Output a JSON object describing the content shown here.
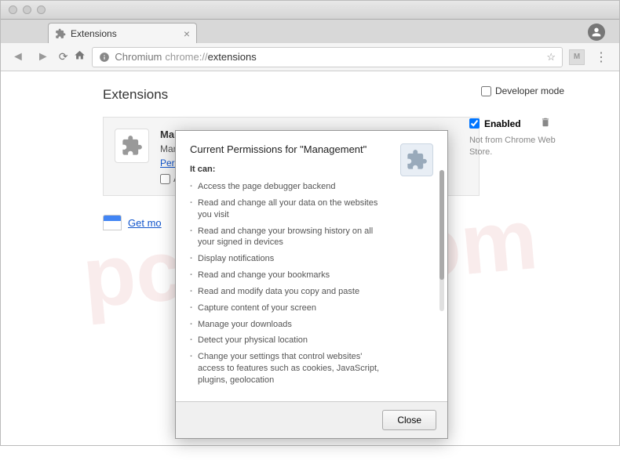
{
  "tab": {
    "title": "Extensions"
  },
  "omnibox": {
    "prefix": "Chromium",
    "grey": "chrome://",
    "path": "extensions"
  },
  "page": {
    "title": "Extensions"
  },
  "extCard": {
    "name": "Mana",
    "desc": "Mana",
    "permissionsLink": "Permi",
    "allowLabel": "Al"
  },
  "getMore": "Get mo",
  "rightPanel": {
    "devMode": "Developer mode",
    "enabled": "Enabled",
    "notFrom": "Not from Chrome Web Store."
  },
  "dialog": {
    "title": "Current Permissions for \"Management\"",
    "itCan": "It can:",
    "permissions": [
      "Access the page debugger backend",
      "Read and change all your data on the websites you visit",
      "Read and change your browsing history on all your signed in devices",
      "Display notifications",
      "Read and change your bookmarks",
      "Read and modify data you copy and paste",
      "Capture content of your screen",
      "Manage your downloads",
      "Detect your physical location",
      "Change your settings that control websites' access to features such as cookies, JavaScript, plugins, geolocation"
    ],
    "closeLabel": "Close"
  },
  "watermark": "pcrisk.com"
}
